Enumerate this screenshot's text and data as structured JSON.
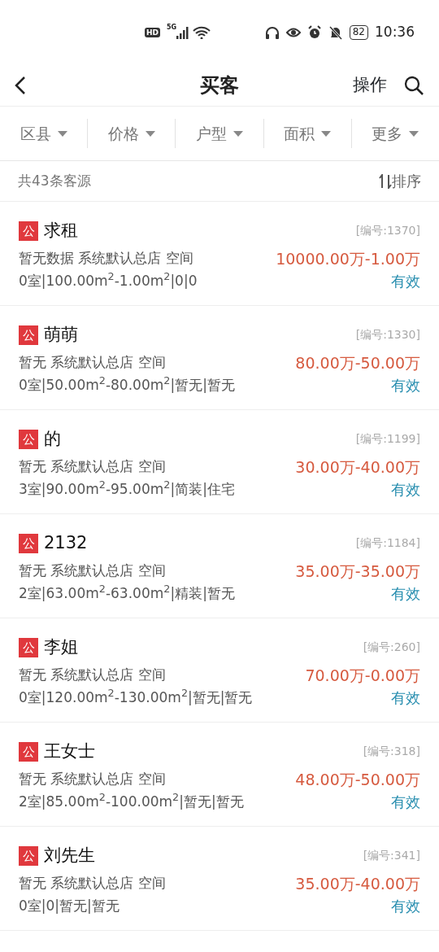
{
  "status_bar": {
    "hd": "HD",
    "network": "5G",
    "battery": "82",
    "time": "10:36"
  },
  "header": {
    "title": "买客",
    "action": "操作"
  },
  "filters": [
    {
      "label": "区县"
    },
    {
      "label": "价格"
    },
    {
      "label": "户型"
    },
    {
      "label": "面积"
    },
    {
      "label": "更多"
    }
  ],
  "summary": {
    "count": "共43条客源",
    "sort": "排序"
  },
  "clients": [
    {
      "badge": "公",
      "name": "求租",
      "code": "[编号:1370]",
      "info": "暂无数据 系统默认总店 空间",
      "price": "10000.00万-1.00万",
      "detail": "0室|100.00m$^{2}$-1.00m$^{2}$|0|0",
      "status": "有效"
    },
    {
      "badge": "公",
      "name": "萌萌",
      "code": "[编号:1330]",
      "info": "暂无 系统默认总店 空间",
      "price": "80.00万-50.00万",
      "detail": "0室|50.00m$^{2}$-80.00m$^{2}$|暂无|暂无",
      "status": "有效"
    },
    {
      "badge": "公",
      "name": "的",
      "code": "[编号:1199]",
      "info": "暂无 系统默认总店 空间",
      "price": "30.00万-40.00万",
      "detail": "3室|90.00m$^{2}$-95.00m$^{2}$|简装|住宅",
      "status": "有效"
    },
    {
      "badge": "公",
      "name": "2132",
      "code": "[编号:1184]",
      "info": "暂无 系统默认总店 空间",
      "price": "35.00万-35.00万",
      "detail": "2室|63.00m$^{2}$-63.00m$^{2}$|精装|暂无",
      "status": "有效"
    },
    {
      "badge": "公",
      "name": "李姐",
      "code": "[编号:260]",
      "info": "暂无 系统默认总店 空间",
      "price": "70.00万-0.00万",
      "detail": "0室|120.00m$^{2}$-130.00m$^{2}$|暂无|暂无",
      "status": "有效"
    },
    {
      "badge": "公",
      "name": "王女士",
      "code": "[编号:318]",
      "info": "暂无 系统默认总店 空间",
      "price": "48.00万-50.00万",
      "detail": "2室|85.00m$^{2}$-100.00m$^{2}$|暂无|暂无",
      "status": "有效"
    },
    {
      "badge": "公",
      "name": "刘先生",
      "code": "[编号:341]",
      "info": "暂无 系统默认总店 空间",
      "price": "35.00万-40.00万",
      "detail": "0室|0|暂无|暂无",
      "status": "有效"
    }
  ]
}
